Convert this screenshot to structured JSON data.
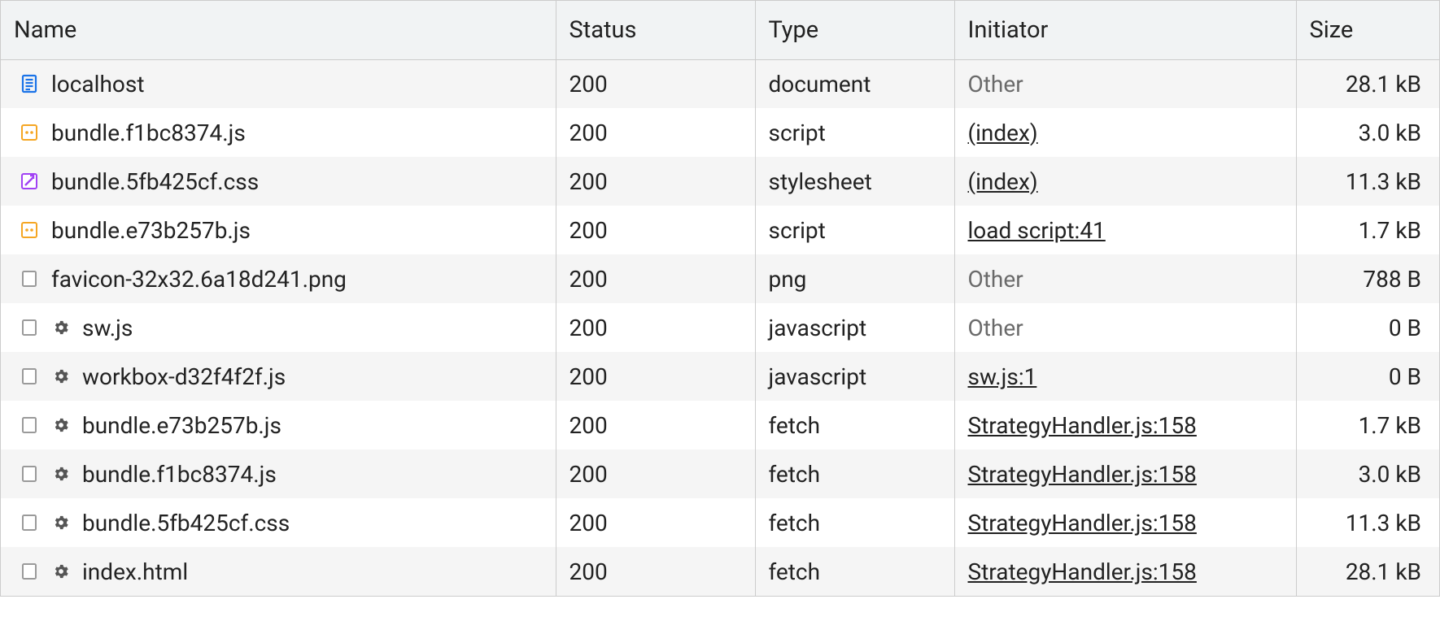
{
  "columns": {
    "name": "Name",
    "status": "Status",
    "type": "Type",
    "initiator": "Initiator",
    "size": "Size"
  },
  "rows": [
    {
      "icon": "document",
      "gear": false,
      "name": "localhost",
      "status": "200",
      "type": "document",
      "initiator": "Other",
      "initiator_link": false,
      "size": "28.1 kB"
    },
    {
      "icon": "js",
      "gear": false,
      "name": "bundle.f1bc8374.js",
      "status": "200",
      "type": "script",
      "initiator": "(index)",
      "initiator_link": true,
      "size": "3.0 kB"
    },
    {
      "icon": "css",
      "gear": false,
      "name": "bundle.5fb425cf.css",
      "status": "200",
      "type": "stylesheet",
      "initiator": "(index)",
      "initiator_link": true,
      "size": "11.3 kB"
    },
    {
      "icon": "js",
      "gear": false,
      "name": "bundle.e73b257b.js",
      "status": "200",
      "type": "script",
      "initiator": "load script:41",
      "initiator_link": true,
      "size": "1.7 kB"
    },
    {
      "icon": "blank",
      "gear": false,
      "name": "favicon-32x32.6a18d241.png",
      "status": "200",
      "type": "png",
      "initiator": "Other",
      "initiator_link": false,
      "size": "788 B"
    },
    {
      "icon": "blank",
      "gear": true,
      "name": "sw.js",
      "status": "200",
      "type": "javascript",
      "initiator": "Other",
      "initiator_link": false,
      "size": "0 B"
    },
    {
      "icon": "blank",
      "gear": true,
      "name": "workbox-d32f4f2f.js",
      "status": "200",
      "type": "javascript",
      "initiator": "sw.js:1",
      "initiator_link": true,
      "size": "0 B"
    },
    {
      "icon": "blank",
      "gear": true,
      "name": "bundle.e73b257b.js",
      "status": "200",
      "type": "fetch",
      "initiator": "StrategyHandler.js:158",
      "initiator_link": true,
      "size": "1.7 kB"
    },
    {
      "icon": "blank",
      "gear": true,
      "name": "bundle.f1bc8374.js",
      "status": "200",
      "type": "fetch",
      "initiator": "StrategyHandler.js:158",
      "initiator_link": true,
      "size": "3.0 kB"
    },
    {
      "icon": "blank",
      "gear": true,
      "name": "bundle.5fb425cf.css",
      "status": "200",
      "type": "fetch",
      "initiator": "StrategyHandler.js:158",
      "initiator_link": true,
      "size": "11.3 kB"
    },
    {
      "icon": "blank",
      "gear": true,
      "name": "index.html",
      "status": "200",
      "type": "fetch",
      "initiator": "StrategyHandler.js:158",
      "initiator_link": true,
      "size": "28.1 kB"
    }
  ]
}
